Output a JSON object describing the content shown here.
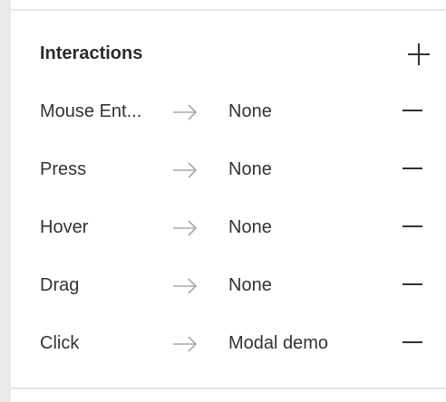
{
  "panel": {
    "title": "Interactions",
    "add_icon": "plus-icon",
    "rows": [
      {
        "event": "Mouse Ent...",
        "target": "None",
        "arrow_icon": "arrow-right-icon",
        "remove_icon": "minus-icon"
      },
      {
        "event": "Press",
        "target": "None",
        "arrow_icon": "arrow-right-icon",
        "remove_icon": "minus-icon"
      },
      {
        "event": "Hover",
        "target": "None",
        "arrow_icon": "arrow-right-icon",
        "remove_icon": "minus-icon"
      },
      {
        "event": "Drag",
        "target": "None",
        "arrow_icon": "arrow-right-icon",
        "remove_icon": "minus-icon"
      },
      {
        "event": "Click",
        "target": "Modal demo",
        "arrow_icon": "arrow-right-icon",
        "remove_icon": "minus-icon"
      }
    ]
  },
  "colors": {
    "text": "#333333",
    "arrow": "#a9a9a9",
    "divider": "#e6e6e6",
    "left_strip": "#e9e9e9"
  }
}
